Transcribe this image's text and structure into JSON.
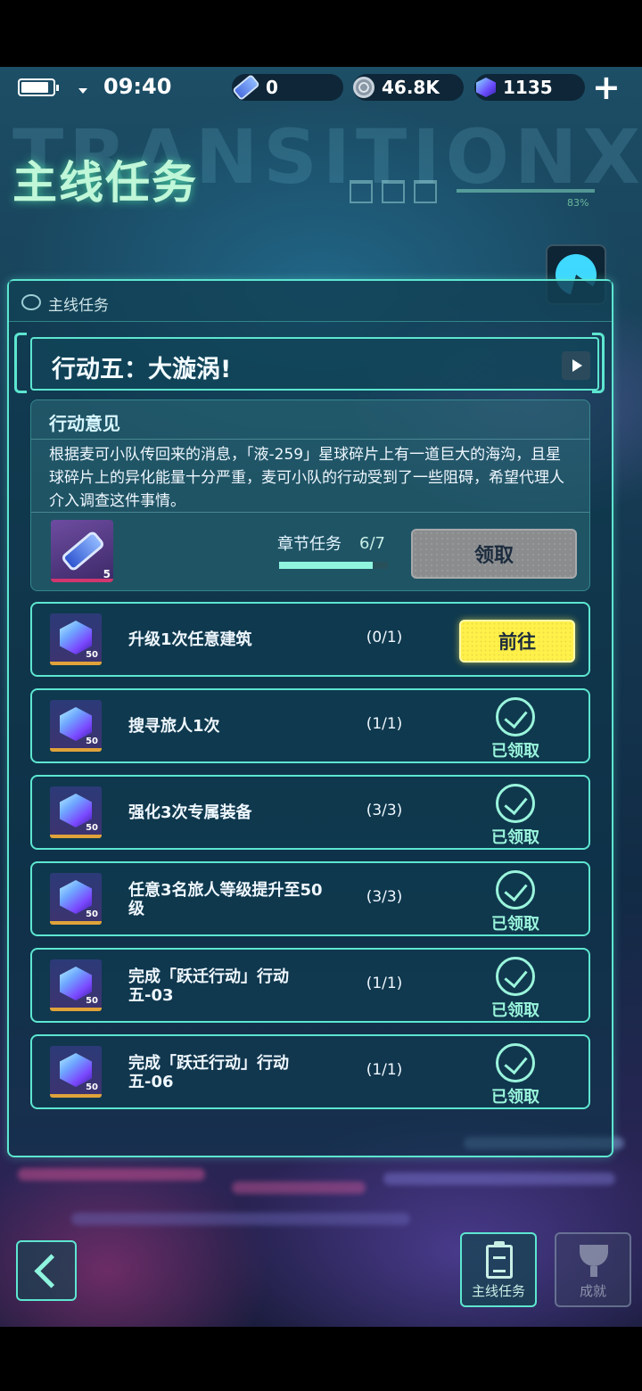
{
  "status_bar": {
    "time": "09:40",
    "resources": [
      {
        "icon": "ticket-icon",
        "value": "0"
      },
      {
        "icon": "coin-icon",
        "value": "46.8K"
      },
      {
        "icon": "cube-gem-icon",
        "value": "1135"
      }
    ],
    "add_label": "+"
  },
  "header": {
    "title": "主线任务",
    "background_word": "TRANSITIONXXX",
    "deco_percent": "83%"
  },
  "panel": {
    "head_label": "主线任务",
    "chapter_title": "行动五：大漩涡!",
    "opinion": {
      "heading": "行动意见",
      "text": "根据麦可小队传回来的消息，「液-259」星球碎片上有一道巨大的海沟，且星球碎片上的异化能量十分严重，麦可小队的行动受到了一些阻碍，希望代理人介入调查这件事情。",
      "reward_count": "5",
      "chapter_task_label": "章节任务",
      "chapter_progress": "6/7",
      "chapter_progress_fraction": 0.857,
      "claim_label": "领取"
    },
    "tasks": [
      {
        "name": "升级1次任意建筑",
        "progress": "(0/1)",
        "reward_count": "50",
        "state": "go",
        "action_label": "前往"
      },
      {
        "name": "搜寻旅人1次",
        "progress": "(1/1)",
        "reward_count": "50",
        "state": "claimed",
        "action_label": "已领取"
      },
      {
        "name": "强化3次专属装备",
        "progress": "(3/3)",
        "reward_count": "50",
        "state": "claimed",
        "action_label": "已领取"
      },
      {
        "name": "任意3名旅人等级提升至50级",
        "progress": "(3/3)",
        "reward_count": "50",
        "state": "claimed",
        "action_label": "已领取"
      },
      {
        "name": "完成「跃迁行动」行动五-03",
        "progress": "(1/1)",
        "reward_count": "50",
        "state": "claimed",
        "action_label": "已领取"
      },
      {
        "name": "完成「跃迁行动」行动五-06",
        "progress": "(1/1)",
        "reward_count": "50",
        "state": "claimed",
        "action_label": "已领取"
      }
    ]
  },
  "bottom_nav": {
    "main_task_label": "主线任务",
    "achievement_label": "成就"
  },
  "colors": {
    "accent": "#5de6d0",
    "go_button": "#fff04a",
    "claimed": "#9af5dc",
    "title_glow": "#bff7d8"
  }
}
